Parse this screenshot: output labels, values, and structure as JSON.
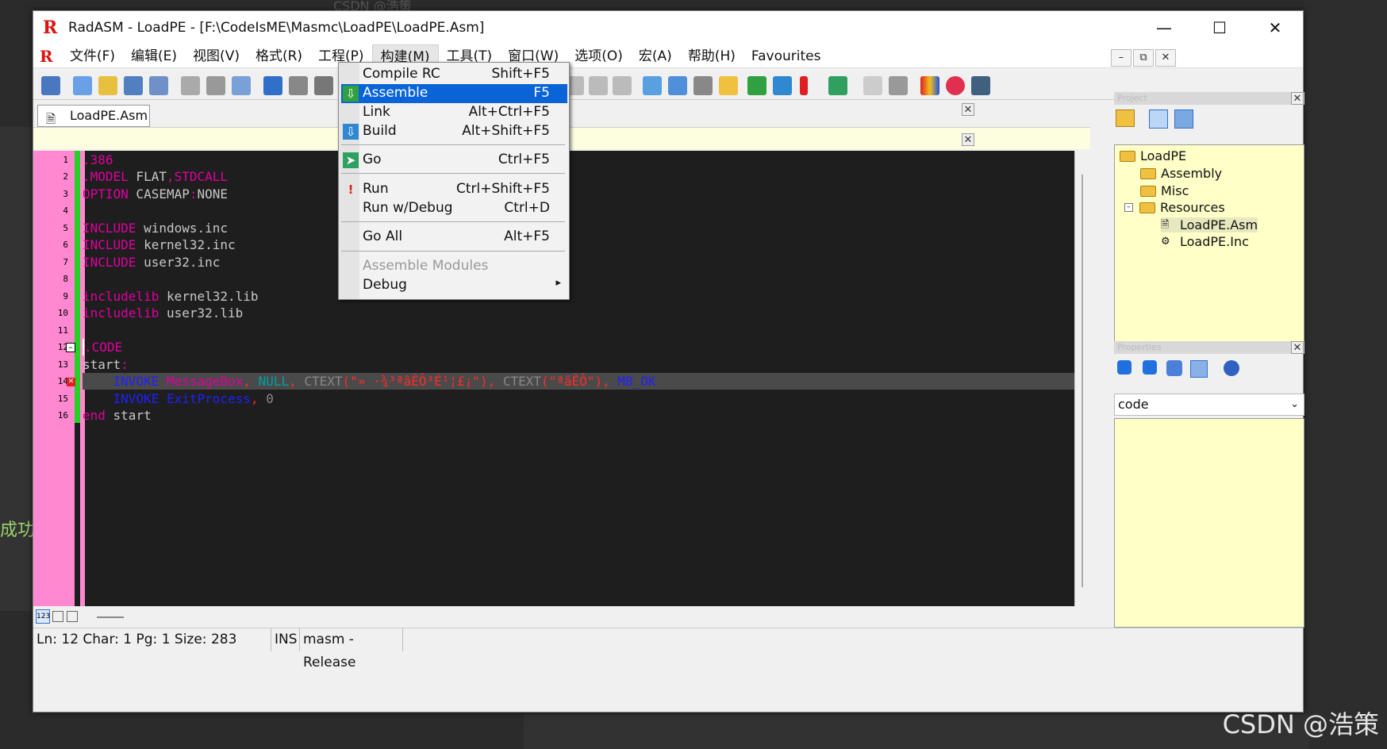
{
  "background": {
    "top_text": "CSDN @浩策",
    "side_text": "成功",
    "watermark": "CSDN @浩策"
  },
  "window": {
    "title": "RadASM - LoadPE - [F:\\CodeIsME\\Masmc\\LoadPE\\LoadPE.Asm]",
    "logo": "R"
  },
  "menubar": {
    "logo": "R",
    "items": [
      "文件(F)",
      "编辑(E)",
      "视图(V)",
      "格式(R)",
      "工程(P)",
      "构建(M)",
      "工具(T)",
      "窗口(W)",
      "选项(O)",
      "宏(A)",
      "帮助(H)",
      "Favourites"
    ]
  },
  "tab": {
    "label": "LoadPE.Asm"
  },
  "editor": {
    "line_numbers": [
      "1",
      "2",
      "3",
      "4",
      "5",
      "6",
      "7",
      "8",
      "9",
      "10",
      "11",
      "12",
      "13",
      "14",
      "15",
      "16"
    ],
    "lines": {
      "l1": ".386",
      "l2a": ".MODEL",
      "l2b": " FLAT",
      "l2c": ",",
      "l2d": "STDCALL",
      "l3a": "OPTION",
      "l3b": " CASEMAP",
      "l3c": ":",
      "l3d": "NONE",
      "l5a": "INCLUDE",
      "l5b": " windows.inc",
      "l6a": "INCLUDE",
      "l6b": " kernel32.inc",
      "l7a": "INCLUDE",
      "l7b": " user32.inc",
      "l9a": "includelib",
      "l9b": " kernel32.lib",
      "l10a": "includelib",
      "l10b": " user32.lib",
      "l12": ".CODE",
      "l13a": "start",
      "l13b": ":",
      "l14a": "INVOKE",
      "l14b": " MessageBox",
      "l14c": ",",
      "l14d": " NULL",
      "l14e": ",",
      "l14f": " CTEXT",
      "l14g": "(\"» ·¾³ªâÊÔ³É¹¦£¡\")",
      "l14h": ",",
      "l14i": " CTEXT",
      "l14j": "(\"ªâÊÔ\")",
      "l14k": ",",
      "l14l": " MB_OK",
      "l15a": "INVOKE",
      "l15b": " ExitProcess",
      "l15c": ",",
      "l15d": " 0",
      "l16a": "end",
      "l16b": " start"
    }
  },
  "build_menu": {
    "items": [
      {
        "label": "Compile RC",
        "shortcut": "Shift+F5"
      },
      {
        "label": "Assemble",
        "shortcut": "F5"
      },
      {
        "label": "Link",
        "shortcut": "Alt+Ctrl+F5"
      },
      {
        "label": "Build",
        "shortcut": "Alt+Shift+F5"
      },
      {
        "label": "Go",
        "shortcut": "Ctrl+F5"
      },
      {
        "label": "Run",
        "shortcut": "Ctrl+Shift+F5"
      },
      {
        "label": "Run w/Debug",
        "shortcut": "Ctrl+D"
      },
      {
        "label": "Go All",
        "shortcut": "Alt+F5"
      },
      {
        "label": "Assemble Modules",
        "shortcut": ""
      },
      {
        "label": "Debug",
        "shortcut": "▸"
      }
    ]
  },
  "project": {
    "header": "Project",
    "tree": [
      "LoadPE",
      "Assembly",
      "Misc",
      "Resources",
      "LoadPE.Asm",
      "LoadPE.Inc"
    ]
  },
  "properties": {
    "header": "Properties",
    "selected": "code"
  },
  "statusbar": {
    "position": "Ln: 12 Char: 1 Pg: 1 Size: 283",
    "mode": "INS",
    "build": "masm - Release"
  },
  "colors": {
    "gutter": "#ff88d0",
    "menu_highlight": "#0a64d8",
    "panel_yellow": "#ffffc8"
  }
}
